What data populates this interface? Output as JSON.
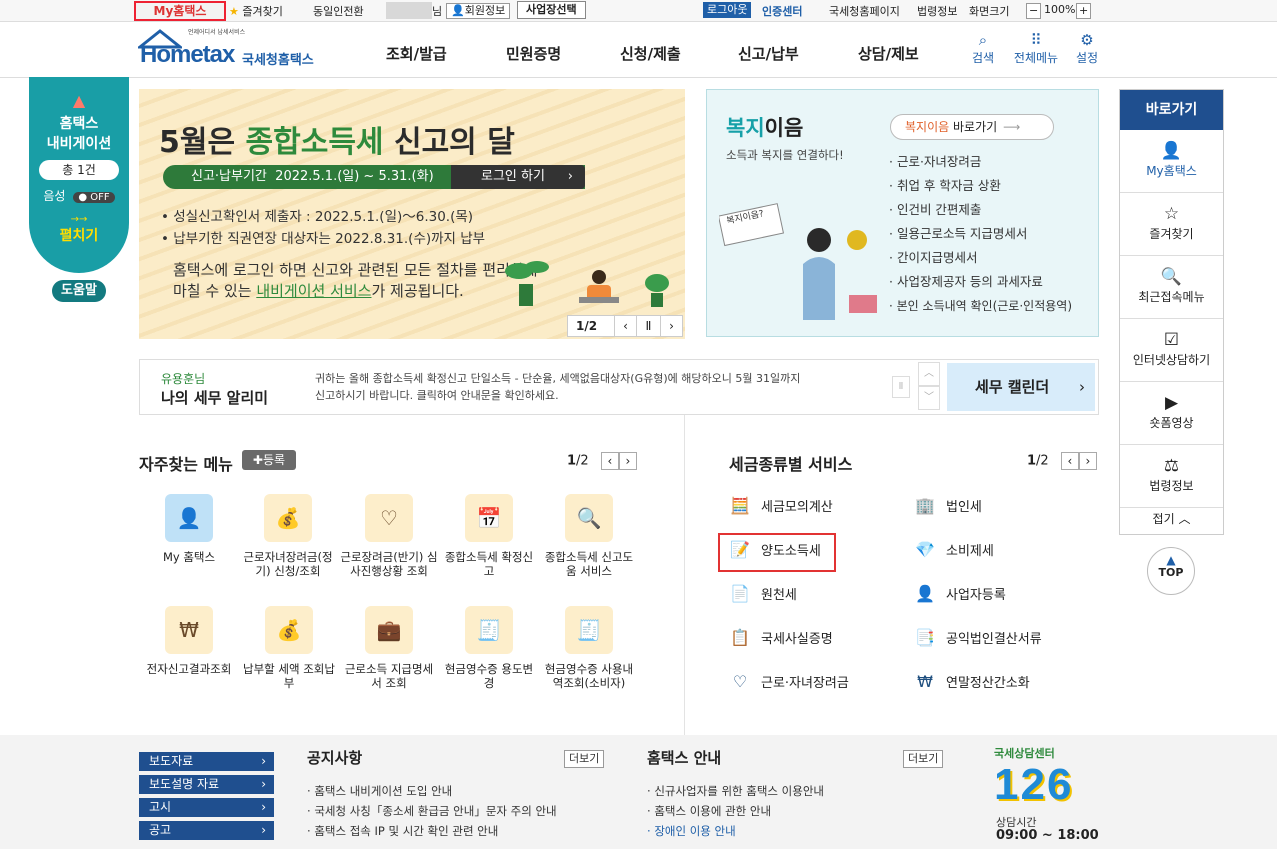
{
  "topbar": {
    "my_hometax": "My홈택스",
    "favorites": "즐겨찾기",
    "consent_switch": "동일인전환",
    "name_suffix": "님",
    "member_info": "회원정보",
    "biz_select": "사업장선택",
    "logout": "로그아웃",
    "cert_center": "인증센터",
    "nts_page": "국세청홈페이지",
    "law_info": "법령정보",
    "screen_size": "화면크기",
    "zoom": "100%"
  },
  "header": {
    "logo_small": "언제어디서 납세서비스",
    "logo_main": "Hometax",
    "logo_sub": "국세청홈택스",
    "nav": [
      "조회/발급",
      "민원증명",
      "신청/제출",
      "신고/납부",
      "상담/제보"
    ],
    "search": "검색",
    "all_menu": "전체메뉴",
    "settings": "설정"
  },
  "leftnav": {
    "title1": "홈택스",
    "title2": "내비게이션",
    "count": "총 1건",
    "voice": "음성",
    "voice_state": "OFF",
    "expand": "펼치기",
    "help": "도움말"
  },
  "banner1": {
    "title_pre": "5월은 ",
    "title_hl": "종합소득세",
    "title_post": " 신고의 달",
    "period_label": "신고·납부기간",
    "period": "2022.5.1.(일) ~ 5.31.(화)",
    "login_btn": "로그인 하기",
    "bullet1": "성실신고확인서 제출자 : 2022.5.1.(일)〜6.30.(목)",
    "bullet2": "납부기한 직권연장 대상자는 2022.8.31.(수)까지 납부",
    "desc1": "홈택스에 로그인 하면 신고와 관련된 모든 절차를 편리하게",
    "desc2_pre": "마칠 수 있는 ",
    "desc2_hl": "내비게이션 서비스",
    "desc2_post": "가 제공됩니다.",
    "page": "1/2"
  },
  "banner2": {
    "title_a": "복지",
    "title_b": "이음",
    "subtitle": "소득과 복지를 연결하다!",
    "go_a": "복지이음",
    "go_b": " 바로가기",
    "sign": "복지이음?",
    "items": [
      "근로·자녀장려금",
      "취업 후 학자금 상환",
      "인건비 간편제출",
      "일용근로소득 지급명세서",
      "간이지급명세서",
      "사업장제공자 등의 과세자료",
      "본인 소득내역 확인(근로·인적용역)"
    ]
  },
  "notice": {
    "tag": "유용훈님",
    "title": "나의 세무 알리미",
    "line1": "귀하는 올해 종합소득세 확정신고 단일소득 - 단순율, 세액없음대상자(G유형)에 해당하오니 5월 31일까지",
    "line2": "신고하시기 바랍니다. 클릭하여 안내문을 확인하세요.",
    "calendar": "세무 캘린더"
  },
  "freq": {
    "title": "자주찾는 메뉴",
    "register": "등록",
    "page_cur": "1",
    "page_total": "/2",
    "items": [
      {
        "label": "My 홈택스",
        "icon": "👤"
      },
      {
        "label": "근로자녀장려금(정기) 신청/조회",
        "icon": "💰"
      },
      {
        "label": "근로장려금(반기) 심사진행상황 조회",
        "icon": "♡"
      },
      {
        "label": "종합소득세 확정신고",
        "icon": "📅"
      },
      {
        "label": "종합소득세 신고도움 서비스",
        "icon": "🔍"
      },
      {
        "label": "전자신고결과조회",
        "icon": "₩"
      },
      {
        "label": "납부할 세액 조회납부",
        "icon": "💰"
      },
      {
        "label": "근로소득 지급명세서 조회",
        "icon": "💼"
      },
      {
        "label": "현금영수증 용도변경",
        "icon": "🧾"
      },
      {
        "label": "현금영수증 사용내역조회(소비자)",
        "icon": "🧾"
      }
    ]
  },
  "taxsvc": {
    "title": "세금종류별 서비스",
    "page_cur": "1",
    "page_total": "/2",
    "col1": [
      {
        "label": "세금모의계산",
        "icon": "🧮"
      },
      {
        "label": "양도소득세",
        "icon": "📝"
      },
      {
        "label": "원천세",
        "icon": "📄"
      },
      {
        "label": "국세사실증명",
        "icon": "📋"
      },
      {
        "label": "근로·자녀장려금",
        "icon": "♡"
      }
    ],
    "col2": [
      {
        "label": "법인세",
        "icon": "🏢"
      },
      {
        "label": "소비제세",
        "icon": "💎"
      },
      {
        "label": "사업자등록",
        "icon": "👤"
      },
      {
        "label": "공익법인결산서류",
        "icon": "📑"
      },
      {
        "label": "연말정산간소화",
        "icon": "₩"
      }
    ]
  },
  "quick": {
    "title": "바로가기",
    "items": [
      "My홈택스",
      "즐겨찾기",
      "최근접속메뉴",
      "인터넷상담하기",
      "숏폼영상",
      "법령정보"
    ],
    "fold": "접기",
    "top": "TOP"
  },
  "footer": {
    "btns": [
      "보도자료",
      "보도설명 자료",
      "고시",
      "공고"
    ],
    "notice_title": "공지사항",
    "notice_more": "더보기",
    "notice_items": [
      "홈택스 내비게이션 도입 안내",
      "국세청 사칭「종소세 환급금 안내」문자 주의 안내",
      "홈택스 접속 IP 및 시간 확인 관련 안내"
    ],
    "guide_title": "홈택스 안내",
    "guide_more": "더보기",
    "guide_items": [
      "신규사업자를 위한 홈택스 이용안내",
      "홈택스 이용에 관한 안내",
      "장애인 이용 안내"
    ],
    "center_title": "국세상담센터",
    "center_num": "126",
    "hours_label": "상담시간",
    "hours": "09:00 ~ 18:00"
  },
  "colors": {
    "brand": "#1f5fa8",
    "teal": "#199ea6",
    "highlight": "#e23333",
    "green": "#2e8a3c"
  }
}
